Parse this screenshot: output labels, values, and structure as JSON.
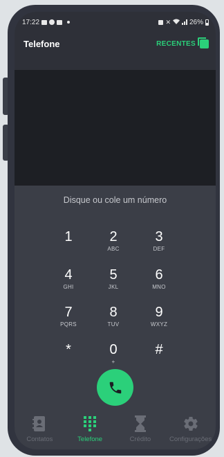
{
  "status_bar": {
    "time": "17:22",
    "battery": "26%"
  },
  "app_bar": {
    "title": "Telefone",
    "recentes_label": "RECENTES"
  },
  "dialer": {
    "prompt": "Disque ou cole um número",
    "keys": [
      {
        "digit": "1",
        "letters": ""
      },
      {
        "digit": "2",
        "letters": "ABC"
      },
      {
        "digit": "3",
        "letters": "DEF"
      },
      {
        "digit": "4",
        "letters": "GHI"
      },
      {
        "digit": "5",
        "letters": "JKL"
      },
      {
        "digit": "6",
        "letters": "MNO"
      },
      {
        "digit": "7",
        "letters": "PQRS"
      },
      {
        "digit": "8",
        "letters": "TUV"
      },
      {
        "digit": "9",
        "letters": "WXYZ"
      },
      {
        "digit": "*",
        "letters": ""
      },
      {
        "digit": "0",
        "letters": "+"
      },
      {
        "digit": "#",
        "letters": ""
      }
    ]
  },
  "bottom_nav": {
    "items": [
      {
        "label": "Contatos",
        "icon": "contacts-icon",
        "active": false
      },
      {
        "label": "Telefone",
        "icon": "dialpad-icon",
        "active": true
      },
      {
        "label": "Crédito",
        "icon": "hourglass-icon",
        "active": false
      },
      {
        "label": "Configurações",
        "icon": "gear-icon",
        "active": false
      }
    ]
  },
  "colors": {
    "accent": "#2bd07a",
    "background": "#3b3e47",
    "display": "#1d1f24",
    "inactive": "#6a6d76"
  }
}
